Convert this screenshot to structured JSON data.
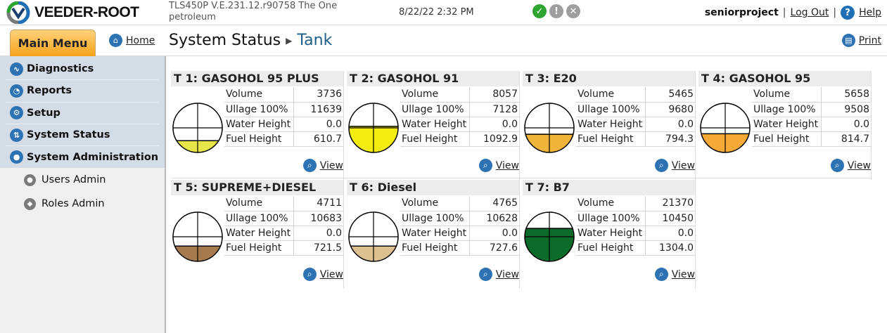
{
  "header": {
    "logo_text": "VEEDER-ROOT",
    "system_info": "TLS450P V.E.231.12.r90758 The One petroleum",
    "datetime": "8/22/22 2:32 PM",
    "status_icons": [
      {
        "name": "ok-icon",
        "glyph": "✓",
        "color": "#2fa531"
      },
      {
        "name": "warning-icon",
        "glyph": "!",
        "color": "#9e9e9e"
      },
      {
        "name": "alarm-icon",
        "glyph": "✕",
        "color": "#9e9e9e"
      }
    ],
    "username": "seniorproject",
    "logout_label": "Log Out",
    "help_label": "Help",
    "separator": "|"
  },
  "titlebar": {
    "main_menu_label": "Main Menu",
    "home_label": "Home",
    "page_title": "System Status",
    "page_subtitle": "Tank",
    "print_label": "Print"
  },
  "sidebar": {
    "items": [
      {
        "label": "Diagnostics",
        "icon": "diagnostics-icon",
        "glyph": "∿"
      },
      {
        "label": "Reports",
        "icon": "reports-icon",
        "glyph": "◔"
      },
      {
        "label": "Setup",
        "icon": "gear-icon",
        "glyph": "⚙"
      },
      {
        "label": "System Status",
        "icon": "system-status-icon",
        "glyph": "⇅"
      },
      {
        "label": "System Administration",
        "icon": "user-icon",
        "glyph": "●"
      }
    ],
    "sub_items": [
      {
        "label": "Users Admin",
        "icon": "users-admin-icon",
        "glyph": "●"
      },
      {
        "label": "Roles Admin",
        "icon": "roles-admin-icon",
        "glyph": "◆"
      }
    ]
  },
  "tank_labels": {
    "volume": "Volume",
    "ullage": "Ullage 100%",
    "water": "Water Height",
    "fuel": "Fuel Height",
    "view": "View"
  },
  "tanks": [
    {
      "title": "T 1: GASOHOL 95 PLUS",
      "volume": "3736",
      "ullage": "11639",
      "water": "0.0",
      "fuel": "610.7",
      "fill_fraction": 0.24,
      "color": "#e6e64a"
    },
    {
      "title": "T 2: GASOHOL 91",
      "volume": "8057",
      "ullage": "7128",
      "water": "0.0",
      "fuel": "1092.9",
      "fill_fraction": 0.53,
      "color": "#f2ec10"
    },
    {
      "title": "T 3: E20",
      "volume": "5465",
      "ullage": "9680",
      "water": "0.0",
      "fuel": "794.3",
      "fill_fraction": 0.37,
      "color": "#f1b43a"
    },
    {
      "title": "T 4: GASOHOL 95",
      "volume": "5658",
      "ullage": "9508",
      "water": "0.0",
      "fuel": "814.7",
      "fill_fraction": 0.38,
      "color": "#f5aa37"
    },
    {
      "title": "T 5: SUPREME+DIESEL",
      "volume": "4711",
      "ullage": "10683",
      "water": "0.0",
      "fuel": "721.5",
      "fill_fraction": 0.31,
      "color": "#a57a4e"
    },
    {
      "title": "T 6: Diesel",
      "volume": "4765",
      "ullage": "10628",
      "water": "0.0",
      "fuel": "727.6",
      "fill_fraction": 0.31,
      "color": "#dcc08f"
    },
    {
      "title": "T 7: B7",
      "volume": "21370",
      "ullage": "10450",
      "water": "0.0",
      "fuel": "1304.0",
      "fill_fraction": 0.67,
      "color": "#0a6b2a"
    }
  ]
}
